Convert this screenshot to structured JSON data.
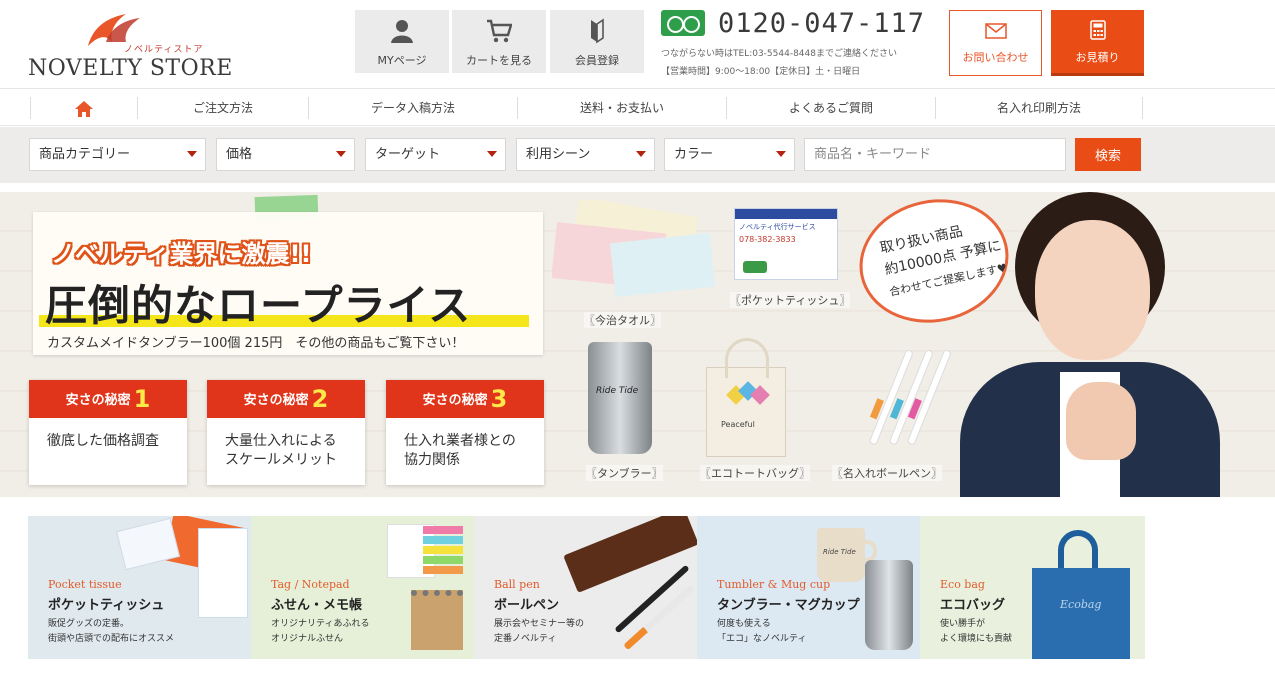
{
  "header": {
    "logo_sub": "ノベルティストア",
    "logo_main": "NOVELTY STORE",
    "buttons": [
      {
        "label": "MYページ",
        "icon": "user-icon"
      },
      {
        "label": "カートを見る",
        "icon": "cart-icon"
      },
      {
        "label": "会員登録",
        "icon": "bookmark-icon"
      }
    ],
    "phone": "0120-047-117",
    "phone_note": "つながらない時はTEL:03-5544-8448までご連絡ください",
    "phone_hours": "【営業時間】9:00〜18:00【定休日】土・日曜日",
    "contact_label": "お問い合わせ",
    "quote_label": "お見積り",
    "accent_color": "#ea4c16"
  },
  "nav": {
    "items": [
      "ご注文方法",
      "データ入稿方法",
      "送料・お支払い",
      "よくあるご質問",
      "名入れ印刷方法"
    ]
  },
  "search": {
    "selects": [
      "商品カテゴリー",
      "価格",
      "ターゲット",
      "利用シーン",
      "カラー"
    ],
    "placeholder": "商品名・キーワード",
    "button": "検索"
  },
  "hero": {
    "headline": "ノベルティ業界に激震!!",
    "main": "圧倒的なロープライス",
    "sub": "カスタムメイドタンブラー100個 215円　その他の商品もご覧下さい！",
    "secrets": [
      {
        "head": "安さの秘密",
        "num": "1",
        "text": "徹底した価格調査"
      },
      {
        "head": "安さの秘密",
        "num": "2",
        "text": "大量仕入れによる\nスケールメリット"
      },
      {
        "head": "安さの秘密",
        "num": "3",
        "text": "仕入れ業者様との\n協力関係"
      }
    ],
    "product_labels": [
      "〖今治タオル〗",
      "〖ポケットティッシュ〗",
      "〖タンブラー〗",
      "〖エコトートバッグ〗",
      "〖名入れボールペン〗"
    ],
    "speech_line1": "取り扱い商品",
    "speech_line2": "約10000点 予算に",
    "speech_line3": "合わせてご提案します♥",
    "tissue_brand": "ノベルティ代行サービス",
    "tissue_tel": "078-382-3833",
    "tumbler_text": "Ride Tide",
    "bag_text": "Peaceful"
  },
  "tiles": [
    {
      "en": "Pocket tissue",
      "ja": "ポケットティッシュ",
      "desc": "販促グッズの定番。\n街頭や店頭での配布にオススメ",
      "bg": "#dfe9ee"
    },
    {
      "en": "Tag / Notepad",
      "ja": "ふせん・メモ帳",
      "desc": "オリジナリティあふれる\nオリジナルふせん",
      "bg": "#e6efd8"
    },
    {
      "en": "Ball pen",
      "ja": "ボールペン",
      "desc": "展示会やセミナー等の\n定番ノベルティ",
      "bg": "#ececec"
    },
    {
      "en": "Tumbler & Mug cup",
      "ja": "タンブラー・マグカップ",
      "desc": "何度も使える\n「エコ」なノベルティ",
      "bg": "#dce8f2"
    },
    {
      "en": "Eco bag",
      "ja": "エコバッグ",
      "desc": "使い勝手が\nよく環境にも貢献",
      "bg": "#e9f0dd"
    }
  ],
  "tile_images": {
    "eco_bag_text": "Ecobag",
    "mug_text": "Ride Tide"
  }
}
